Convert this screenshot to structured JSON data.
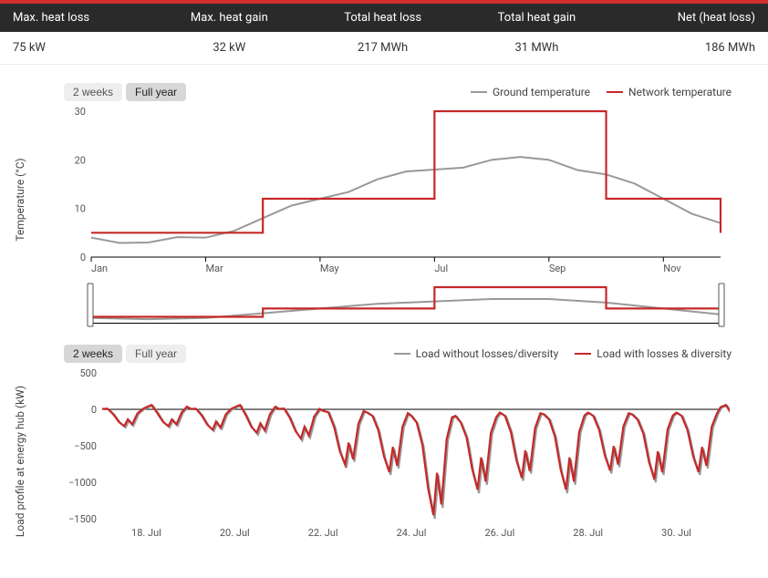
{
  "stats": {
    "headers": [
      "Max. heat loss",
      "Max. heat gain",
      "Total heat loss",
      "Total heat gain",
      "Net (heat loss)"
    ],
    "values": [
      "75 kW",
      "32 kW",
      "217 MWh",
      "31 MWh",
      "186 MWh"
    ]
  },
  "chart1": {
    "controls": {
      "twoWeeks": "2 weeks",
      "fullYear": "Full year"
    },
    "legend": {
      "ground": "Ground temperature",
      "network": "Network temperature"
    },
    "ylabel": "Temperature (°C)",
    "colors": {
      "ground": "#999999",
      "network": "#c62828"
    }
  },
  "chart2": {
    "controls": {
      "twoWeeks": "2 weeks",
      "fullYear": "Full year"
    },
    "legend": {
      "without": "Load without losses/diversity",
      "with": "Load with losses & diversity"
    },
    "ylabel": "Load profile at energy hub (kW)",
    "colors": {
      "without": "#999999",
      "with": "#c62828"
    }
  },
  "chart_data": [
    {
      "type": "line",
      "title": "",
      "xlabel": "",
      "ylabel": "Temperature (°C)",
      "ylim": [
        0,
        30
      ],
      "xticks": [
        "Jan",
        "Mar",
        "May",
        "Jul",
        "Sep",
        "Nov"
      ],
      "yticks": [
        0,
        10,
        20,
        30
      ],
      "series": [
        {
          "name": "Ground temperature",
          "x_months": [
            "Jan",
            "Feb",
            "Mar",
            "Apr",
            "May",
            "Jun",
            "Jul",
            "Aug",
            "Sep",
            "Oct",
            "Nov",
            "Dec"
          ],
          "values": [
            4,
            3,
            4,
            8,
            12,
            16,
            18,
            20,
            20,
            17,
            12,
            7
          ]
        },
        {
          "name": "Network temperature",
          "x_months": [
            "Jan",
            "Feb",
            "Mar",
            "Apr",
            "May",
            "Jun",
            "Jul",
            "Aug",
            "Sep",
            "Oct",
            "Nov",
            "Dec"
          ],
          "values": [
            5,
            5,
            5,
            12,
            12,
            12,
            30,
            30,
            30,
            12,
            12,
            5
          ],
          "step": true
        }
      ]
    },
    {
      "type": "line",
      "title": "",
      "xlabel": "",
      "ylabel": "Load profile at energy hub (kW)",
      "ylim": [
        -1500,
        500
      ],
      "xticks": [
        "18. Jul",
        "20. Jul",
        "22. Jul",
        "24. Jul",
        "26. Jul",
        "28. Jul",
        "30. Jul"
      ],
      "yticks": [
        -1500,
        -1000,
        -500,
        0,
        500
      ],
      "series": [
        {
          "name": "Load without losses/diversity",
          "x_days": [
            17,
            18,
            19,
            20,
            21,
            22,
            23,
            24,
            25,
            26,
            27,
            28,
            29,
            30,
            31
          ],
          "daily_min": [
            -250,
            -250,
            -300,
            -350,
            -430,
            -800,
            -900,
            -1500,
            -1150,
            -980,
            -1150,
            -880,
            -1000,
            -900,
            -300
          ],
          "daily_max": [
            0,
            50,
            0,
            50,
            0,
            -50,
            -100,
            -200,
            -200,
            -100,
            -150,
            -100,
            -150,
            -100,
            50
          ]
        },
        {
          "name": "Load with losses & diversity",
          "x_days": [
            17,
            18,
            19,
            20,
            21,
            22,
            23,
            24,
            25,
            26,
            27,
            28,
            29,
            30,
            31
          ],
          "daily_min": [
            -230,
            -230,
            -280,
            -320,
            -400,
            -760,
            -860,
            -1450,
            -1100,
            -940,
            -1100,
            -840,
            -960,
            -860,
            -280
          ],
          "daily_max": [
            10,
            60,
            10,
            60,
            10,
            -40,
            -90,
            -180,
            -180,
            -90,
            -140,
            -90,
            -140,
            -90,
            60
          ]
        }
      ]
    }
  ]
}
